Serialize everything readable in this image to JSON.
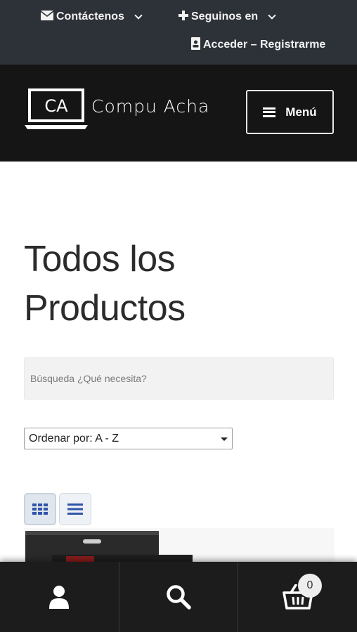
{
  "topbar": {
    "contact_label": "Contáctenos",
    "follow_label": "Seguinos en",
    "login_label": "Acceder – Registrarme"
  },
  "header": {
    "logo_mark": "CA",
    "logo_text": "Compu Acha",
    "menu_label": "Menú"
  },
  "main": {
    "title_line1": "Todos los",
    "title_line2": "Productos",
    "search_placeholder": "Búsqueda ¿Qué necesita?",
    "sort_selected": "Ordenar por: A - Z"
  },
  "bottom_nav": {
    "items": [
      {
        "icon": "user-icon"
      },
      {
        "icon": "search-icon"
      },
      {
        "icon": "basket-icon"
      }
    ],
    "cart_count": "0"
  },
  "colors": {
    "topbar_bg": "#2d3238",
    "header_bg": "#151515",
    "bottomnav_bg": "#1c1c1c",
    "accent_blue": "#2f54a8"
  }
}
